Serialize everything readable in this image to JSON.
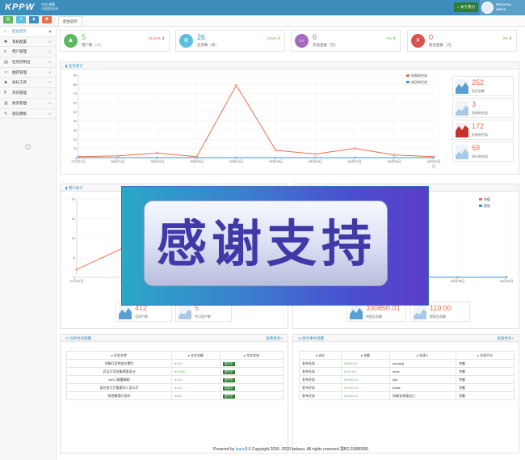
{
  "header": {
    "logo": "KPPW",
    "logo_sub1": "众包 威客",
    "logo_sub2": "开源建站系统",
    "about_us": "关于我们",
    "welcome_line1": "Welcome,",
    "welcome_line2": "admin",
    "tab": "后台首页"
  },
  "quick_buttons": [
    {
      "icon": "chart-icon",
      "color": "#5cb85c"
    },
    {
      "icon": "document-icon",
      "color": "#5bc0de"
    },
    {
      "icon": "user-icon",
      "color": "#3c8dbc"
    },
    {
      "icon": "gear-icon",
      "color": "#e8704e"
    }
  ],
  "sidebar": {
    "items": [
      {
        "label": "后台首页",
        "icon": "home-icon",
        "active": true
      },
      {
        "label": "系统配置",
        "icon": "gear-icon"
      },
      {
        "label": "用户管理",
        "icon": "list-icon"
      },
      {
        "label": "任务控制台",
        "icon": "table-icon"
      },
      {
        "label": "推荐管理",
        "icon": "share-icon"
      },
      {
        "label": "站长工具",
        "icon": "user-icon"
      },
      {
        "label": "资讯管理",
        "icon": "money-icon"
      },
      {
        "label": "财务管理",
        "icon": "bar-chart-icon"
      },
      {
        "label": "短信模板",
        "icon": "edit-icon"
      }
    ]
  },
  "stats": [
    {
      "value": "5",
      "label": "用户数（人）",
      "change": "15.67%",
      "direction": "down",
      "color": "#5cb85c",
      "icon": "users-icon"
    },
    {
      "value": "26",
      "label": "任务数（条）",
      "change": "225%",
      "direction": "up",
      "color": "#5bc0de",
      "icon": "task-icon"
    },
    {
      "value": "0",
      "label": "充值金额（元）",
      "change": "0%",
      "direction": "up",
      "color": "#a569bd",
      "icon": "wallet-icon"
    },
    {
      "value": "0",
      "label": "提现金额（元）",
      "change": "0%",
      "direction": "up",
      "color": "#d9534f",
      "icon": "yen-icon"
    }
  ],
  "task_panel": {
    "title": "任务统计",
    "cards": [
      {
        "value": "252",
        "label": "总任务数",
        "color": "#e8704e",
        "spark": "#5a9fd4"
      },
      {
        "value": "3",
        "label": "完成的任务",
        "color": "#e8704e",
        "spark": "#5a9fd4"
      },
      {
        "value": "172",
        "label": "失败的任务",
        "color": "#e8704e",
        "spark": "#c9302c"
      },
      {
        "value": "59",
        "label": "进行的任务",
        "color": "#e8704e",
        "spark": "#5a9fd4"
      }
    ]
  },
  "user_panel": {
    "title": "用户统计",
    "cards": [
      {
        "value": "412",
        "label": "总用户数"
      },
      {
        "value": "5",
        "label": "今日用户数"
      }
    ]
  },
  "finance_panel": {
    "title": "财务统计",
    "cards": [
      {
        "value": "330850.01",
        "label": "充值总金额"
      },
      {
        "value": "110.00",
        "label": "提现总金额"
      }
    ]
  },
  "task_list": {
    "title": "任务时间提醒",
    "more": "查看更多>",
    "columns": [
      "任务名称",
      "任务金额",
      "任务状态"
    ],
    "rows": [
      [
        "节能灯宣传软文撰写",
        "¥100",
        "进行中"
      ],
      [
        "武汉大学形象牌面设计",
        "¥20000",
        "进行中"
      ],
      [
        "wet二维墨辅助",
        "¥100",
        "进行中"
      ],
      [
        "层任务大厅看看别人怎么写",
        "¥100",
        "招标中"
      ],
      [
        "快把康我开发好",
        "¥200",
        "进行中"
      ]
    ]
  },
  "finance_list": {
    "title": "财务事件提醒",
    "more": "查看更多>",
    "columns": [
      "流水",
      "金额",
      "申请人",
      "交易平台"
    ],
    "rows": [
      [
        "发布任务",
        "¥5000.00",
        "sunnydj",
        "余额"
      ],
      [
        "发布任务",
        "¥101.00",
        "erpic",
        "余额"
      ],
      [
        "发布任务",
        "¥1000.00",
        "lplp",
        "余额"
      ],
      [
        "发布任务",
        "¥1000.00",
        "muke",
        "余额"
      ],
      [
        "发布任务",
        "¥1000.00",
        "你敢金装我自己",
        "余额"
      ]
    ]
  },
  "overlay": {
    "text": "感谢支持"
  },
  "footer": {
    "prefix": "Powered by ",
    "link": "kppw",
    "suffix": "3.0 Copyright 2009 -2020 kekezu. All rights reserved 鄂B2-20080005"
  },
  "chart_data": [
    {
      "type": "line",
      "title": "任务统计",
      "categories": [
        "07月31日",
        "08月01日",
        "08月02日",
        "08月03日",
        "08月04日",
        "08月05日",
        "08月06日",
        "08月07日",
        "08月08日",
        "08月09日"
      ],
      "ylim": [
        0,
        90
      ],
      "yticks": [
        0,
        10,
        20,
        30,
        40,
        50,
        60,
        70,
        80,
        90
      ],
      "series": [
        {
          "name": "失败的任务",
          "color": "#e8704e",
          "values": [
            1,
            2,
            5,
            1,
            79,
            8,
            4,
            10,
            3,
            1
          ]
        },
        {
          "name": "成功的任务",
          "color": "#3498db",
          "values": [
            0,
            0,
            0,
            0,
            0,
            0,
            0,
            0,
            0,
            0
          ]
        }
      ],
      "xaxis_suffix": "日",
      "legend": "top-right",
      "grid": true
    },
    {
      "type": "line",
      "title": "用户统计",
      "categories": [
        "07月31日",
        "08月01日",
        "08月02日"
      ],
      "yticks": [
        0,
        5,
        10,
        15,
        20
      ],
      "ylim": [
        0,
        20
      ],
      "series": [
        {
          "name": "用户数",
          "color": "#e8704e",
          "values": [
            2,
            8,
            15
          ]
        }
      ],
      "grid": true
    },
    {
      "type": "line",
      "title": "财务统计",
      "categories": [
        "08月05日",
        "08月06日",
        "08月07日",
        "08月08日",
        "08月09日"
      ],
      "series": [
        {
          "name": "充值",
          "color": "#e8704e",
          "values": [
            0,
            0,
            0,
            0,
            0
          ]
        },
        {
          "name": "提现",
          "color": "#3498db",
          "values": [
            0,
            0,
            0,
            0,
            0
          ]
        }
      ],
      "legend": "top-right",
      "grid": true
    }
  ]
}
